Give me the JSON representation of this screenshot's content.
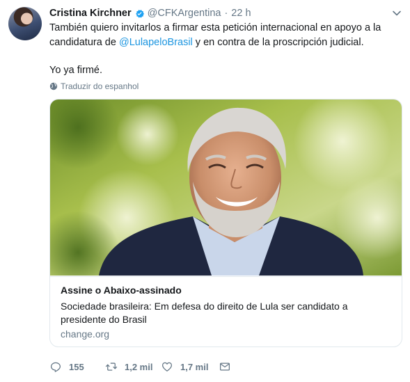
{
  "tweet": {
    "author_name": "Cristina Kirchner",
    "author_handle": "@CFKArgentina",
    "separator": "·",
    "time": "22 h",
    "text_part1": "También quiero invitarlos a firmar esta petición internacional en apoyo a la candidatura de ",
    "mention": "@LulapeloBrasil",
    "text_part2": " y en contra de la proscripción judicial.",
    "text_line2": "Yo ya firmé.",
    "translate_label": "Traduzir do espanhol"
  },
  "card": {
    "title": "Assine o Abaixo-assinado",
    "description": "Sociedade brasileira: Em defesa do direito de Lula ser candidato a presidente do Brasil",
    "domain": "change.org"
  },
  "actions": {
    "replies": "155",
    "retweets": "1,2 mil",
    "likes": "1,7 mil"
  },
  "colors": {
    "accent": "#1b95e0",
    "muted": "#657786",
    "verified": "#1da1f2"
  },
  "icons": [
    "verified-badge-icon",
    "chevron-down-icon",
    "globe-icon",
    "reply-icon",
    "retweet-icon",
    "like-icon",
    "direct-message-icon"
  ]
}
